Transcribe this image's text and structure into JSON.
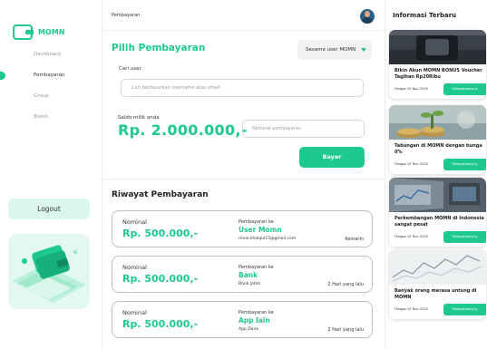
{
  "brand": {
    "name": "MOMN",
    "accent": "#1dc98e"
  },
  "sidebar": {
    "items": [
      {
        "label": "Dashboard",
        "active": false
      },
      {
        "label": "Pembayaran",
        "active": true
      },
      {
        "label": "Group",
        "active": false
      },
      {
        "label": "Bisnis",
        "active": false
      }
    ],
    "logout_label": "Logout"
  },
  "header": {
    "breadcrumb": "Pembayaran"
  },
  "payment": {
    "title": "Pilih Pembayaran",
    "method_select": "Sesama user MOMN",
    "user_label": "Cari user",
    "user_placeholder": "Cari berdasarkan username atau email",
    "balance_label": "Saldo milik anda",
    "balance_value": "Rp. 2.000.000,-",
    "nominal_placeholder": "Nominal pembayaran",
    "pay_button": "Bayar"
  },
  "history": {
    "title": "Riwayat Pembayaran",
    "items": [
      {
        "label": "Nominal",
        "amount": "Rp. 500.000,-",
        "to_label": "Pembayaran ke",
        "name": "User Momn",
        "sub": "rinno.khalqul15@gmail.com",
        "time": "Kemarin"
      },
      {
        "label": "Nominal",
        "amount": "Rp. 500.000,-",
        "to_label": "Pembayaran ke",
        "name": "Bank",
        "sub": "Bank Jatim",
        "time": "2 Hari yang lalu"
      },
      {
        "label": "Nominal",
        "amount": "Rp. 500.000,-",
        "to_label": "Pembayaran ke",
        "name": "App lain",
        "sub": "App Dana",
        "time": "2 Hari yang lalu"
      }
    ]
  },
  "news": {
    "title": "Informasi Terbaru",
    "items": [
      {
        "title": "Bikin Akun MOMN BONUS Voucher Tagihan Rp20Ribu",
        "date": "Hingga 15 Nov 2020",
        "button": "Selengkapnya"
      },
      {
        "title": "Tabungan di MOMN dengan bunga 0%",
        "date": "Hingga 15 Nov 2020",
        "button": "Selengkapnya"
      },
      {
        "title": "Perkembangan MOMN di Indonesia sangat pesat",
        "date": "Hingga 15 Nov 2020",
        "button": "Selengkapnya"
      },
      {
        "title": "Banyak orang merasa untung di MOMN",
        "date": "Hingga 15 Nov 2020",
        "button": "Selengkapnya"
      }
    ]
  }
}
